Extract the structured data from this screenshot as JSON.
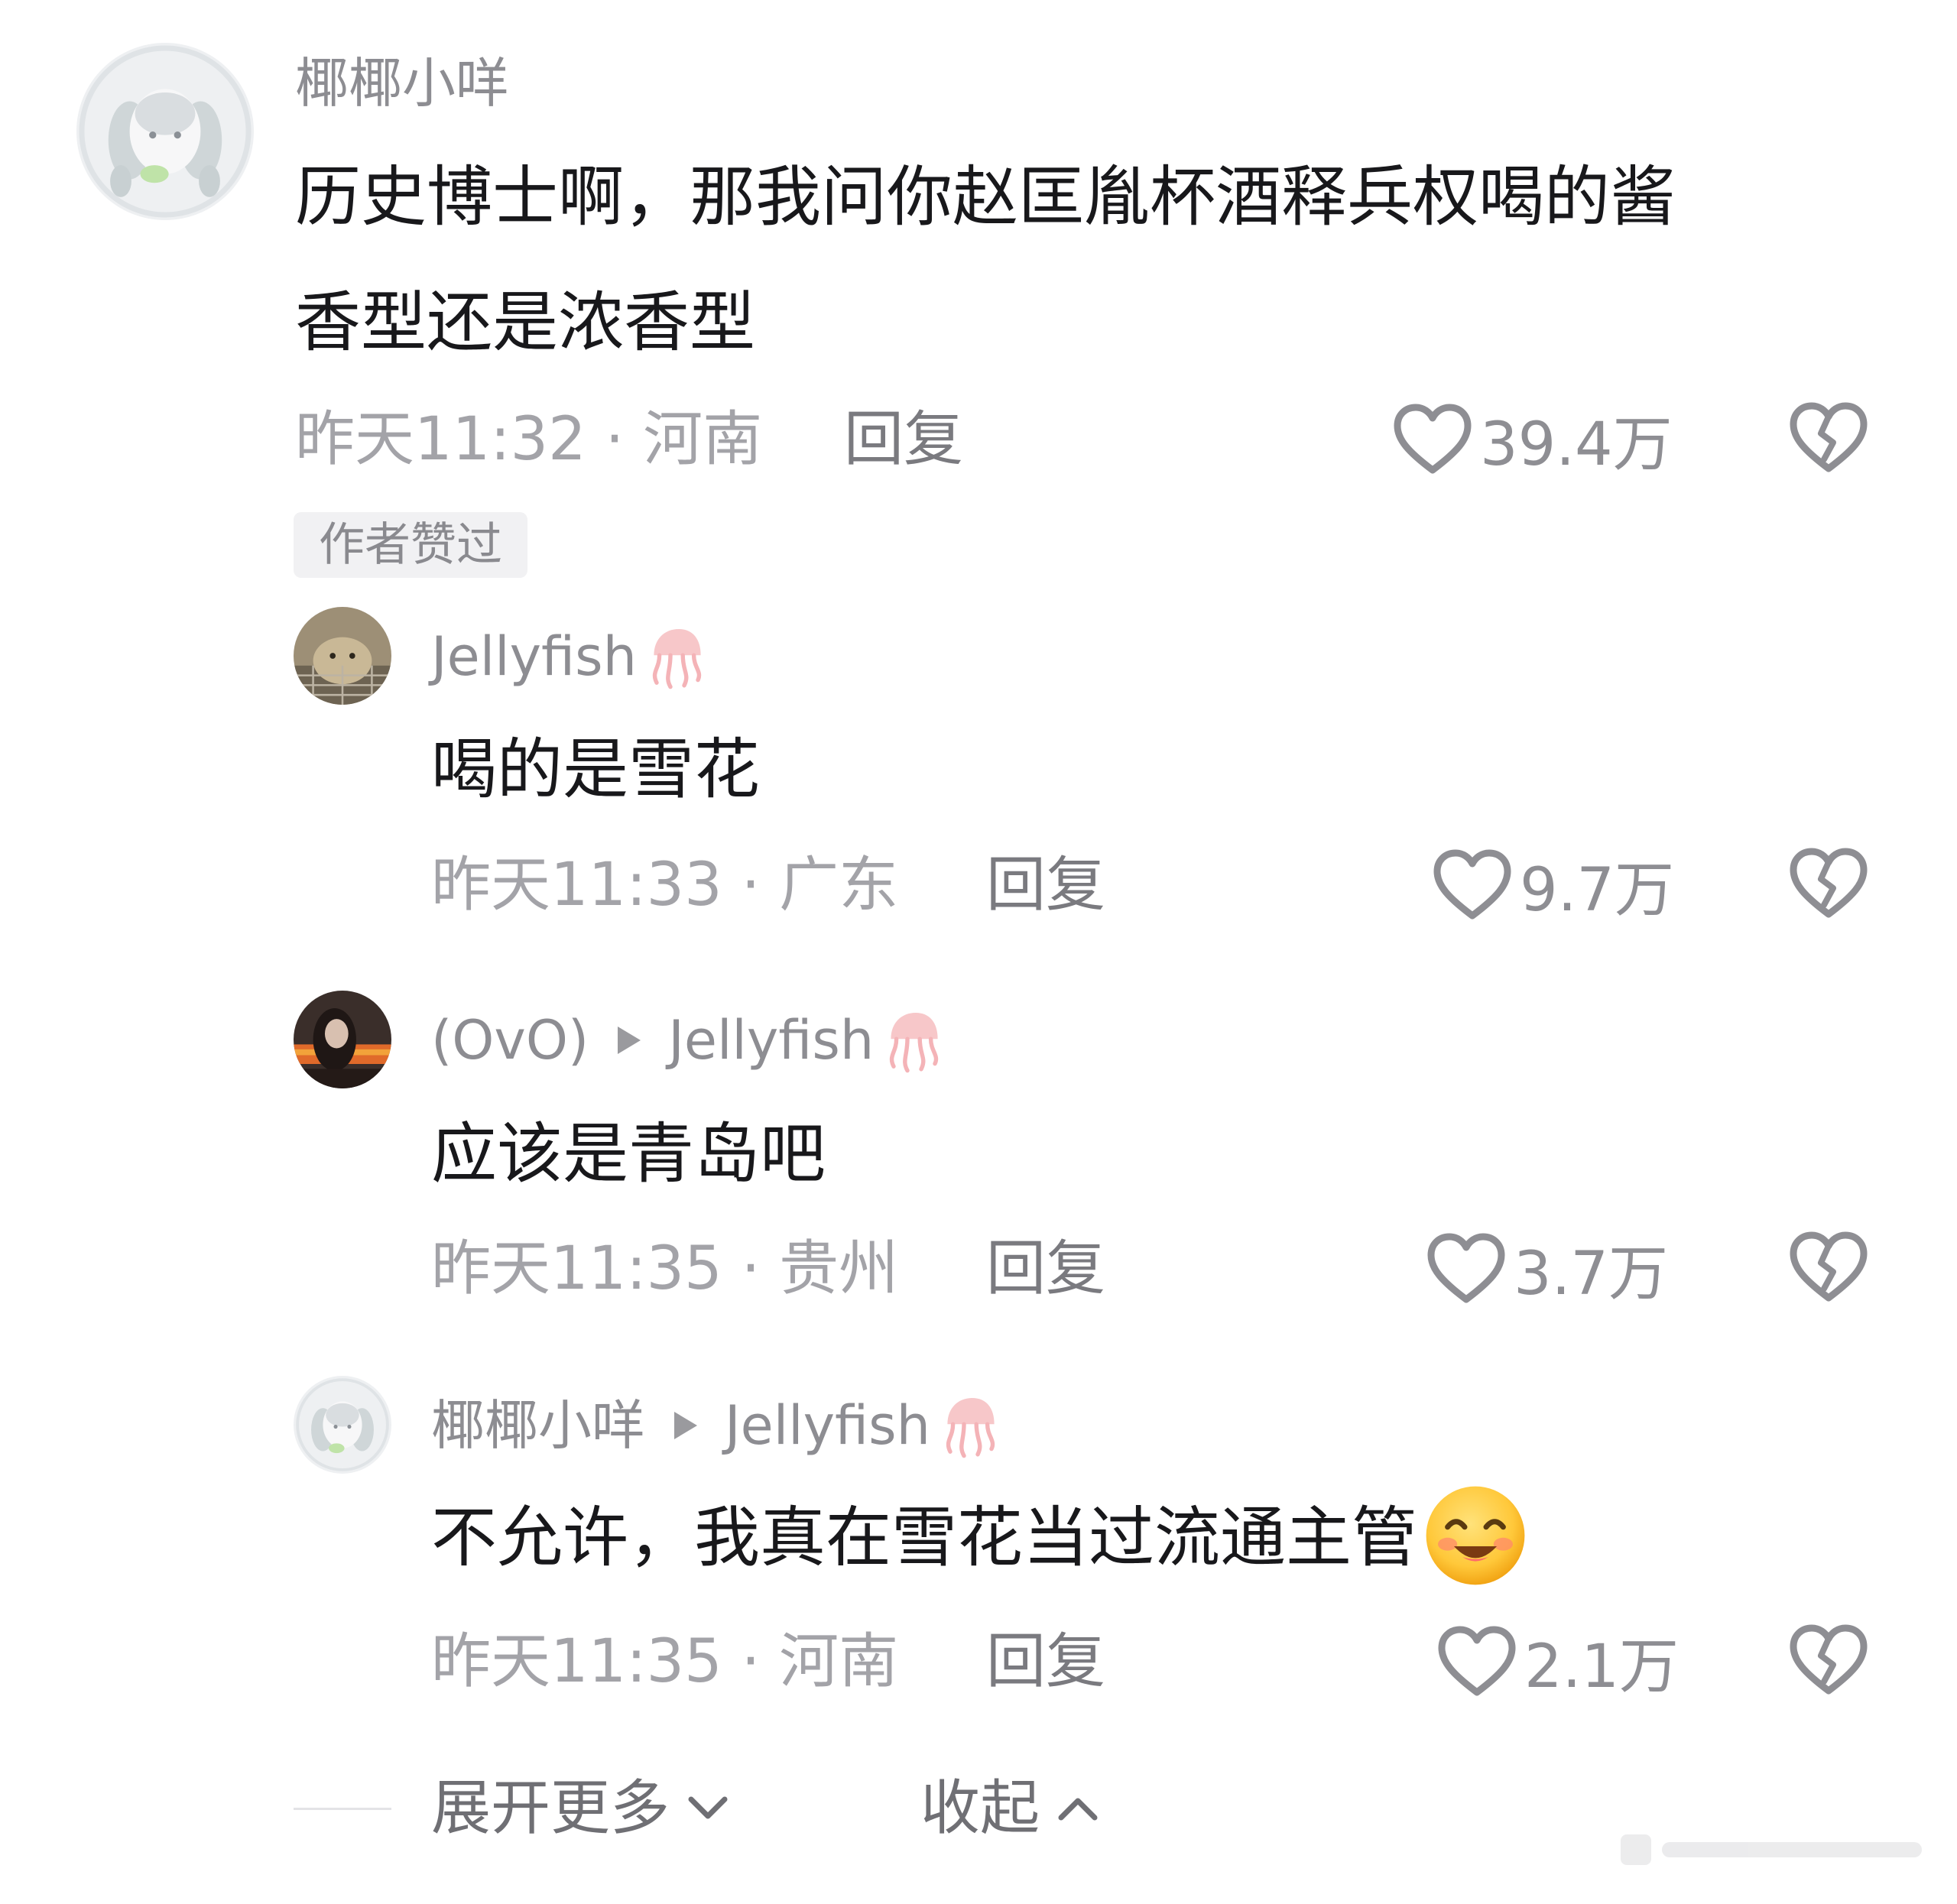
{
  "colors": {
    "text_primary": "#18181b",
    "text_secondary": "#8d8d92",
    "icon": "#8e8e93",
    "badge_bg": "#f1f1f3"
  },
  "comments": [
    {
      "username": "椰椰小咩",
      "content_line1": "历史博士啊，那我问你赵匡胤杯酒释兵权喝的酱",
      "content_line2": "香型还是浓香型",
      "meta": "昨天11:32 · 河南",
      "reply_label": "回复",
      "likes": "39.4万",
      "badge": "作者赞过"
    }
  ],
  "replies": [
    {
      "username": "Jellyfish",
      "username_emoji": "jellyfish-emoji",
      "content": "喝的是雪花",
      "meta": "昨天11:33 · 广东",
      "reply_label": "回复",
      "likes": "9.7万"
    },
    {
      "username": "(OvO)",
      "reply_to": "Jellyfish",
      "username_emoji": "jellyfish-emoji",
      "content": "应该是青岛吧",
      "meta": "昨天11:35 · 贵州",
      "reply_label": "回复",
      "likes": "3.7万"
    },
    {
      "username": "椰椰小咩",
      "reply_to": "Jellyfish",
      "username_emoji": "jellyfish-emoji",
      "content": "不允许，我真在雪花当过流通主管",
      "content_emoji": "smiling-face-emoji",
      "meta": "昨天11:35 · 河南",
      "reply_label": "回复",
      "likes": "2.1万"
    }
  ],
  "footer": {
    "expand_label": "展开更多",
    "collapse_label": "收起"
  },
  "icons": {
    "like": "heart-outline-icon",
    "dislike": "broken-heart-icon",
    "expand": "chevron-down-icon",
    "collapse": "chevron-up-icon",
    "reply_arrow": "triangle-right-icon"
  }
}
